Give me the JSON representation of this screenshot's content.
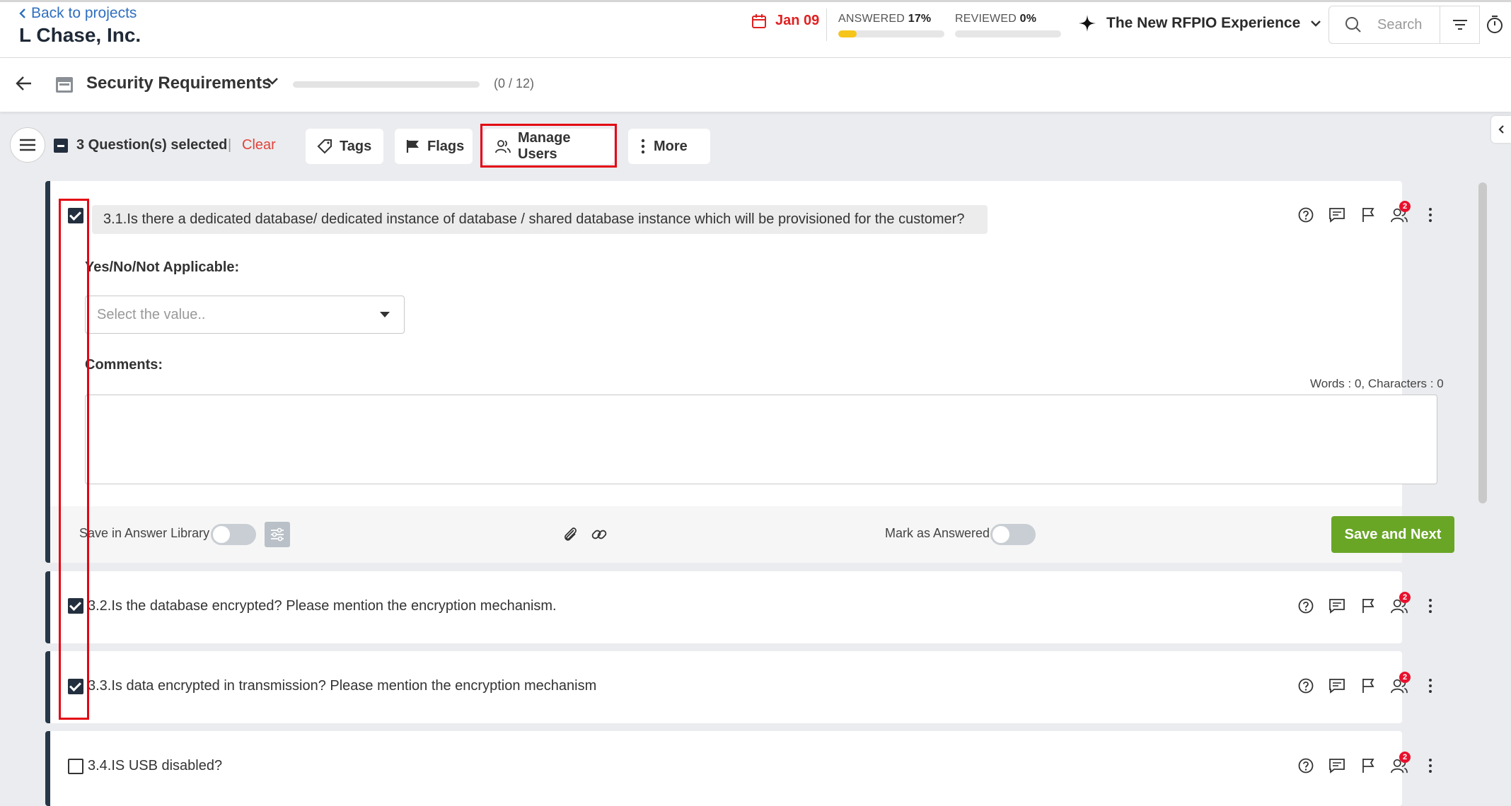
{
  "header": {
    "back_label": "Back to projects",
    "project_name": "L Chase, Inc.",
    "due_date": "Jan 09",
    "answered_label": "ANSWERED",
    "answered_value": "17%",
    "answered_fraction": 0.17,
    "reviewed_label": "REVIEWED",
    "reviewed_value": "0%",
    "reviewed_fraction": 0,
    "experience_label": "The New RFPIO Experience",
    "search_placeholder": "Search"
  },
  "section": {
    "title": "Security Requirements",
    "progress_fraction": 0,
    "progress_text": "(0 / 12)"
  },
  "toolbar": {
    "selected_text": "3 Question(s) selected",
    "separator": "|",
    "clear_label": "Clear",
    "tags_label": "Tags",
    "flags_label": "Flags",
    "manage_users_label": "Manage Users",
    "more_label": "More"
  },
  "questions": [
    {
      "text": "3.1.Is there a dedicated database/ dedicated instance of database / shared database instance which will be provisioned for the customer?",
      "checked": true,
      "assignee_count": "2"
    },
    {
      "text": "3.2.Is the database encrypted? Please mention the encryption mechanism.",
      "checked": true,
      "assignee_count": "2"
    },
    {
      "text": "3.3.Is data encrypted in transmission? Please mention the encryption mechanism",
      "checked": true,
      "assignee_count": "2"
    },
    {
      "text": "3.4.IS USB disabled?",
      "checked": false,
      "assignee_count": "2"
    }
  ],
  "answer_form": {
    "yesno_label": "Yes/No/Not Applicable:",
    "select_placeholder": "Select the value..",
    "comments_label": "Comments:",
    "word_count": "Words : 0, Characters : 0",
    "save_library_label": "Save in Answer Library",
    "mark_answered_label": "Mark as Answered",
    "save_next_label": "Save and Next"
  },
  "colors": {
    "accent_red": "#e30613",
    "brand_dark": "#253748",
    "save_green": "#69a626",
    "progress_yellow": "#f5c51a",
    "link_blue": "#2f6fbf"
  },
  "icons": [
    "chevron-left-icon",
    "calendar-icon",
    "sparkle-icon",
    "chevron-down-icon",
    "search-icon",
    "filter-icon",
    "timer-icon",
    "arrow-left-icon",
    "menu-icon",
    "tag-icon",
    "flag-icon",
    "users-icon",
    "more-vertical-icon",
    "help-icon",
    "comment-icon",
    "assign-user-icon",
    "paperclip-icon",
    "link-icon",
    "settings-sliders-icon"
  ]
}
